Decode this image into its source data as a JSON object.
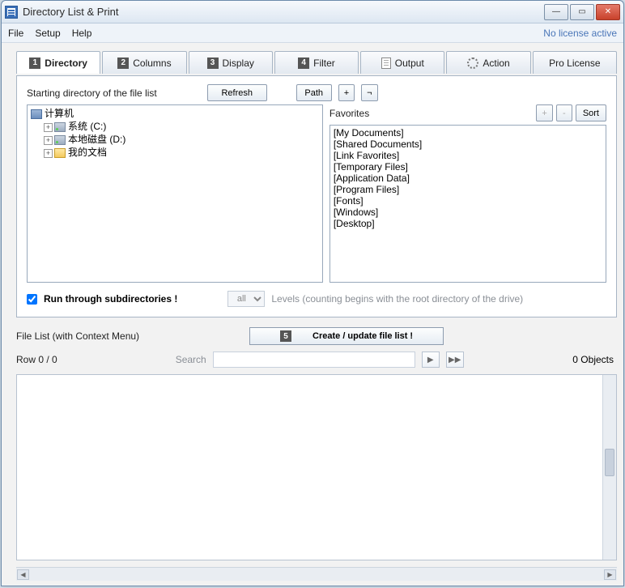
{
  "window": {
    "title": "Directory List & Print"
  },
  "menu": {
    "file": "File",
    "setup": "Setup",
    "help": "Help",
    "license_status": "No license active"
  },
  "tabs": [
    {
      "num": "1",
      "label": "Directory",
      "active": true
    },
    {
      "num": "2",
      "label": "Columns"
    },
    {
      "num": "3",
      "label": "Display"
    },
    {
      "num": "4",
      "label": "Filter"
    },
    {
      "icon": "sheet",
      "label": "Output"
    },
    {
      "icon": "gear",
      "label": "Action"
    },
    {
      "label": "Pro License"
    }
  ],
  "directory_panel": {
    "start_label": "Starting directory of the file list",
    "refresh": "Refresh",
    "path": "Path",
    "plus": "+",
    "neg": "¬",
    "tree": {
      "root": "计算机",
      "children": [
        {
          "label": "系统 (C:)",
          "icon": "drive"
        },
        {
          "label": "本地磁盘 (D:)",
          "icon": "drive"
        },
        {
          "label": "我的文档",
          "icon": "folder"
        }
      ]
    },
    "favorites_label": "Favorites",
    "fav_plus": "+",
    "fav_minus": "-",
    "fav_sort": "Sort",
    "favorites": [
      "[My Documents]",
      "[Shared Documents]",
      "[Link Favorites]",
      "[Temporary Files]",
      "[Application Data]",
      "[Program Files]",
      "[Fonts]",
      "[Windows]",
      "[Desktop]"
    ],
    "subdir_check_label": "Run through subdirectories !",
    "levels_combo": "all",
    "levels_label": "Levels  (counting begins with the root directory of the drive)"
  },
  "filelist": {
    "header_label": "File List (with Context Menu)",
    "create_num": "5",
    "create_label": "Create / update file list !",
    "row_label": "Row 0 / 0",
    "search_label": "Search",
    "objects_label": "0 Objects"
  }
}
